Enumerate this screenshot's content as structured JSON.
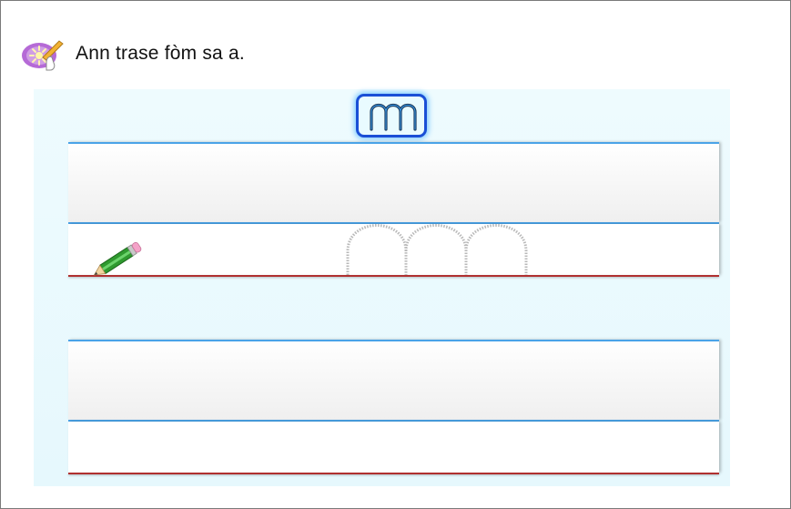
{
  "instruction": {
    "text": "Ann trase fòm sa a.",
    "icon": "pointer-tap-icon"
  },
  "letter_card": {
    "letter": "m",
    "icon": "letter-m-card"
  },
  "writing_area": {
    "bands": 2,
    "pencil_icon": "pencil-icon",
    "trace_guide": "dotted-letter-m-guide"
  },
  "colors": {
    "guide_line": "#4aa3e8",
    "base_line": "#b03030",
    "card_border": "#1a4fd6",
    "background": "#e6f8fd"
  }
}
